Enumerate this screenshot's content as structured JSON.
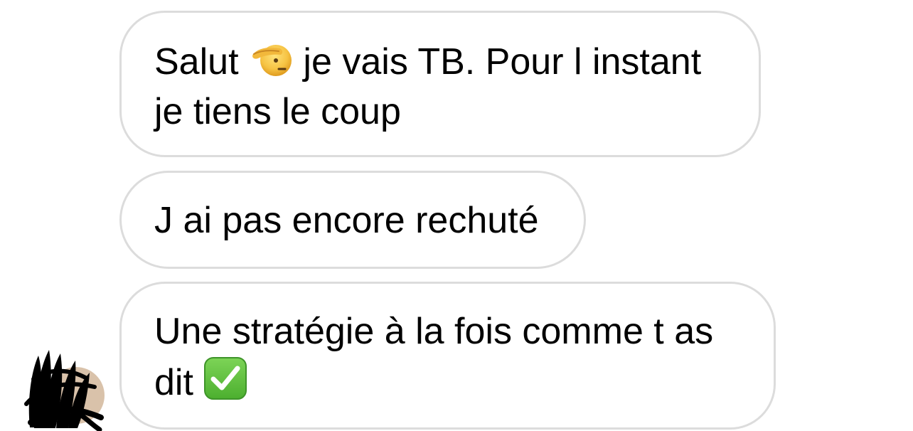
{
  "conversation": {
    "messages": [
      {
        "line1_before_emoji": "Salut ",
        "emoji": "saluting-face",
        "line1_after_emoji": " je vais TB. Pour l instant",
        "line2": "je tiens le coup"
      },
      {
        "line1": "J ai pas encore rechuté"
      },
      {
        "line1": "Une stratégie à la fois comme t as",
        "line2_before_emoji": "dit ",
        "emoji": "check-mark-button"
      }
    ],
    "sender_avatar": {
      "state": "scribbled-over"
    }
  },
  "colors": {
    "bubble_border": "#dcdcdc",
    "bubble_background": "#ffffff",
    "text": "#000000",
    "emoji_yellow": "#f6c343",
    "check_green": "#63c13f"
  }
}
